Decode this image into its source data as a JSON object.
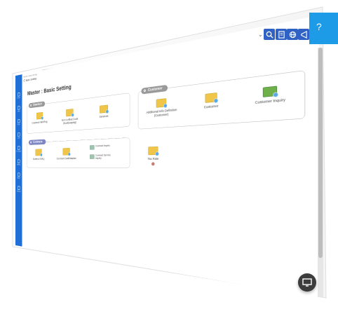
{
  "breadcrumb": {
    "path": "Master / Basic Setting",
    "title": "Basic Setting"
  },
  "page_title": "Master : Basic Setting",
  "sidebar": {
    "items": [
      {
        "label": "Home"
      },
      {
        "label": "Sales"
      },
      {
        "label": "Order"
      },
      {
        "label": "Stock"
      },
      {
        "label": "Purchase"
      },
      {
        "label": "Billing"
      },
      {
        "label": "Master"
      },
      {
        "label": "Settings"
      }
    ]
  },
  "groups": {
    "standard": {
      "title": "Standard",
      "tiles": [
        "Corporate Info Reg.",
        "Item Unified Code (Bookkeeping)",
        "Services"
      ]
    },
    "customer": {
      "title": "Customer",
      "tiles": [
        "Additional Info Definition (Customer)",
        "Customer",
        "Customer Inquiry"
      ]
    },
    "contracts": {
      "title": "Contracts",
      "tiles": [
        "Contract Entry",
        "Contract Confirmation"
      ],
      "minis": [
        "Contract Inquiry",
        "Contract Service Inquiry"
      ]
    },
    "tax": {
      "label": "Tax Rate"
    }
  },
  "toolbar": {
    "help": "?"
  },
  "colors": {
    "rail": "#1f6fd6",
    "toolbar": "#2f62c4",
    "help": "#1d9be7"
  }
}
